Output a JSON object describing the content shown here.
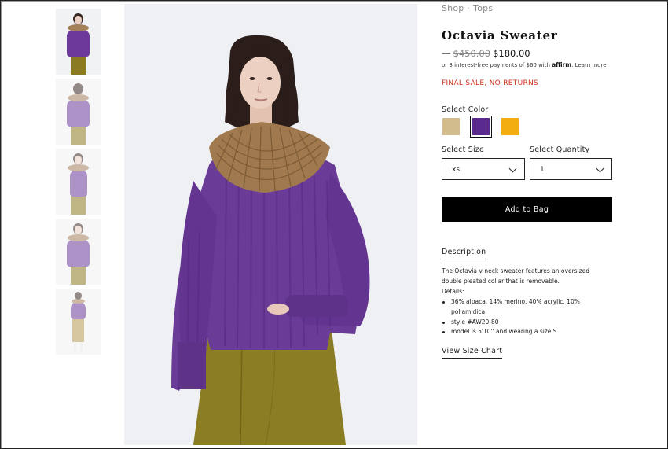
{
  "breadcrumb": {
    "items": [
      "Shop",
      "Tops"
    ],
    "separator": "·"
  },
  "product": {
    "title": "Octavia Sweater",
    "price_dash": "—",
    "original_price": "$450.00",
    "sale_price": "$180.00",
    "installments_text": "or 3 interest-free payments of $60 with",
    "affirm_brand": "affirm",
    "learn_more": "Learn more",
    "final_sale": "FINAL SALE, NO RETURNS"
  },
  "color": {
    "label": "Select Color",
    "swatches": [
      {
        "name": "tan",
        "hex": "#d2bb8c",
        "selected": false
      },
      {
        "name": "purple",
        "hex": "#5b2a8e",
        "selected": true
      },
      {
        "name": "yellow",
        "hex": "#f4ad10",
        "selected": false
      }
    ]
  },
  "size": {
    "label": "Select Size",
    "value": "xs"
  },
  "quantity": {
    "label": "Select Quantity",
    "value": "1"
  },
  "add_to_bag": "Add to Bag",
  "description": {
    "tab_label": "Description",
    "text": "The Octavia v-neck sweater features an oversized double pleated collar that is removable.",
    "details_label": "Details:",
    "details": [
      "36% alpaca, 14% merino, 40% acrylic, 10% poliamidica",
      "style #AW20-80",
      "model is 5'10'' and wearing a size S"
    ]
  },
  "size_chart_link": "View Size Chart",
  "colors": {
    "sweater": "#6a3c98",
    "collar": "#a07a4e",
    "skirt": "#8b7d23",
    "sale_red": "#d0301c"
  }
}
